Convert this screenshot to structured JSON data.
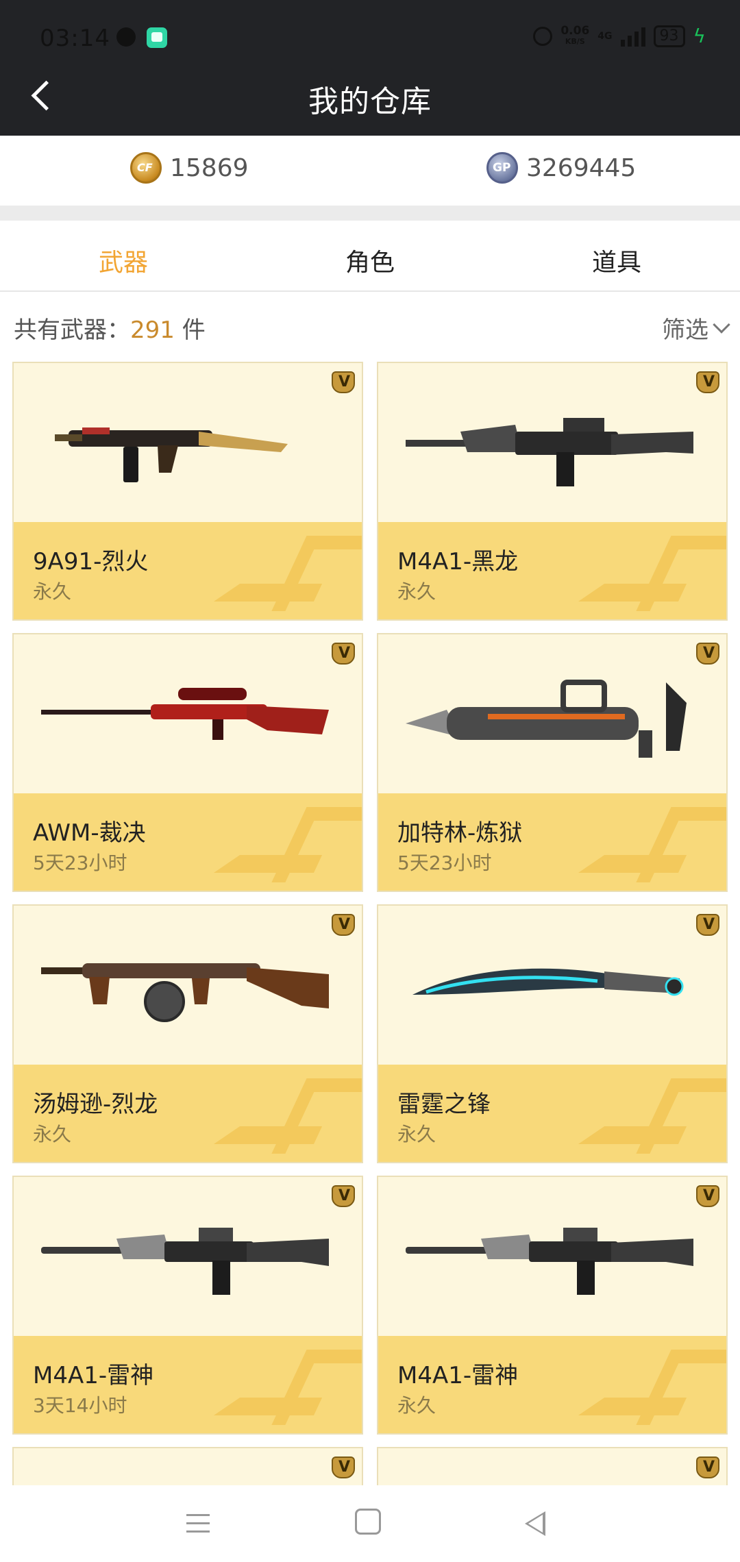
{
  "status_bar": {
    "time": "03:14",
    "net_speed_value": "0.06",
    "net_speed_unit": "KB/S",
    "network": "4G",
    "battery": "93"
  },
  "header": {
    "title": "我的仓库"
  },
  "currency": {
    "cf_points": "15869",
    "gp": "3269445"
  },
  "tabs": [
    {
      "label": "武器",
      "active": true
    },
    {
      "label": "角色",
      "active": false
    },
    {
      "label": "道具",
      "active": false
    }
  ],
  "summary": {
    "prefix": "共有武器：",
    "count": "291",
    "unit": " 件",
    "filter_label": "筛选"
  },
  "weapons": [
    {
      "name": "9A91-烈火",
      "duration": "永久"
    },
    {
      "name": "M4A1-黑龙",
      "duration": "永久"
    },
    {
      "name": "AWM-裁决",
      "duration": "5天23小时"
    },
    {
      "name": "加特林-炼狱",
      "duration": "5天23小时"
    },
    {
      "name": "汤姆逊-烈龙",
      "duration": "永久"
    },
    {
      "name": "雷霆之锋",
      "duration": "永久"
    },
    {
      "name": "M4A1-雷神",
      "duration": "3天14小时"
    },
    {
      "name": "M4A1-雷神",
      "duration": "永久"
    }
  ],
  "colors": {
    "accent": "#f2a533",
    "header_bg": "#222326",
    "card_info_bg": "#f8d97a",
    "card_image_bg": "#fdf7de",
    "count_color": "#c98a2c"
  }
}
